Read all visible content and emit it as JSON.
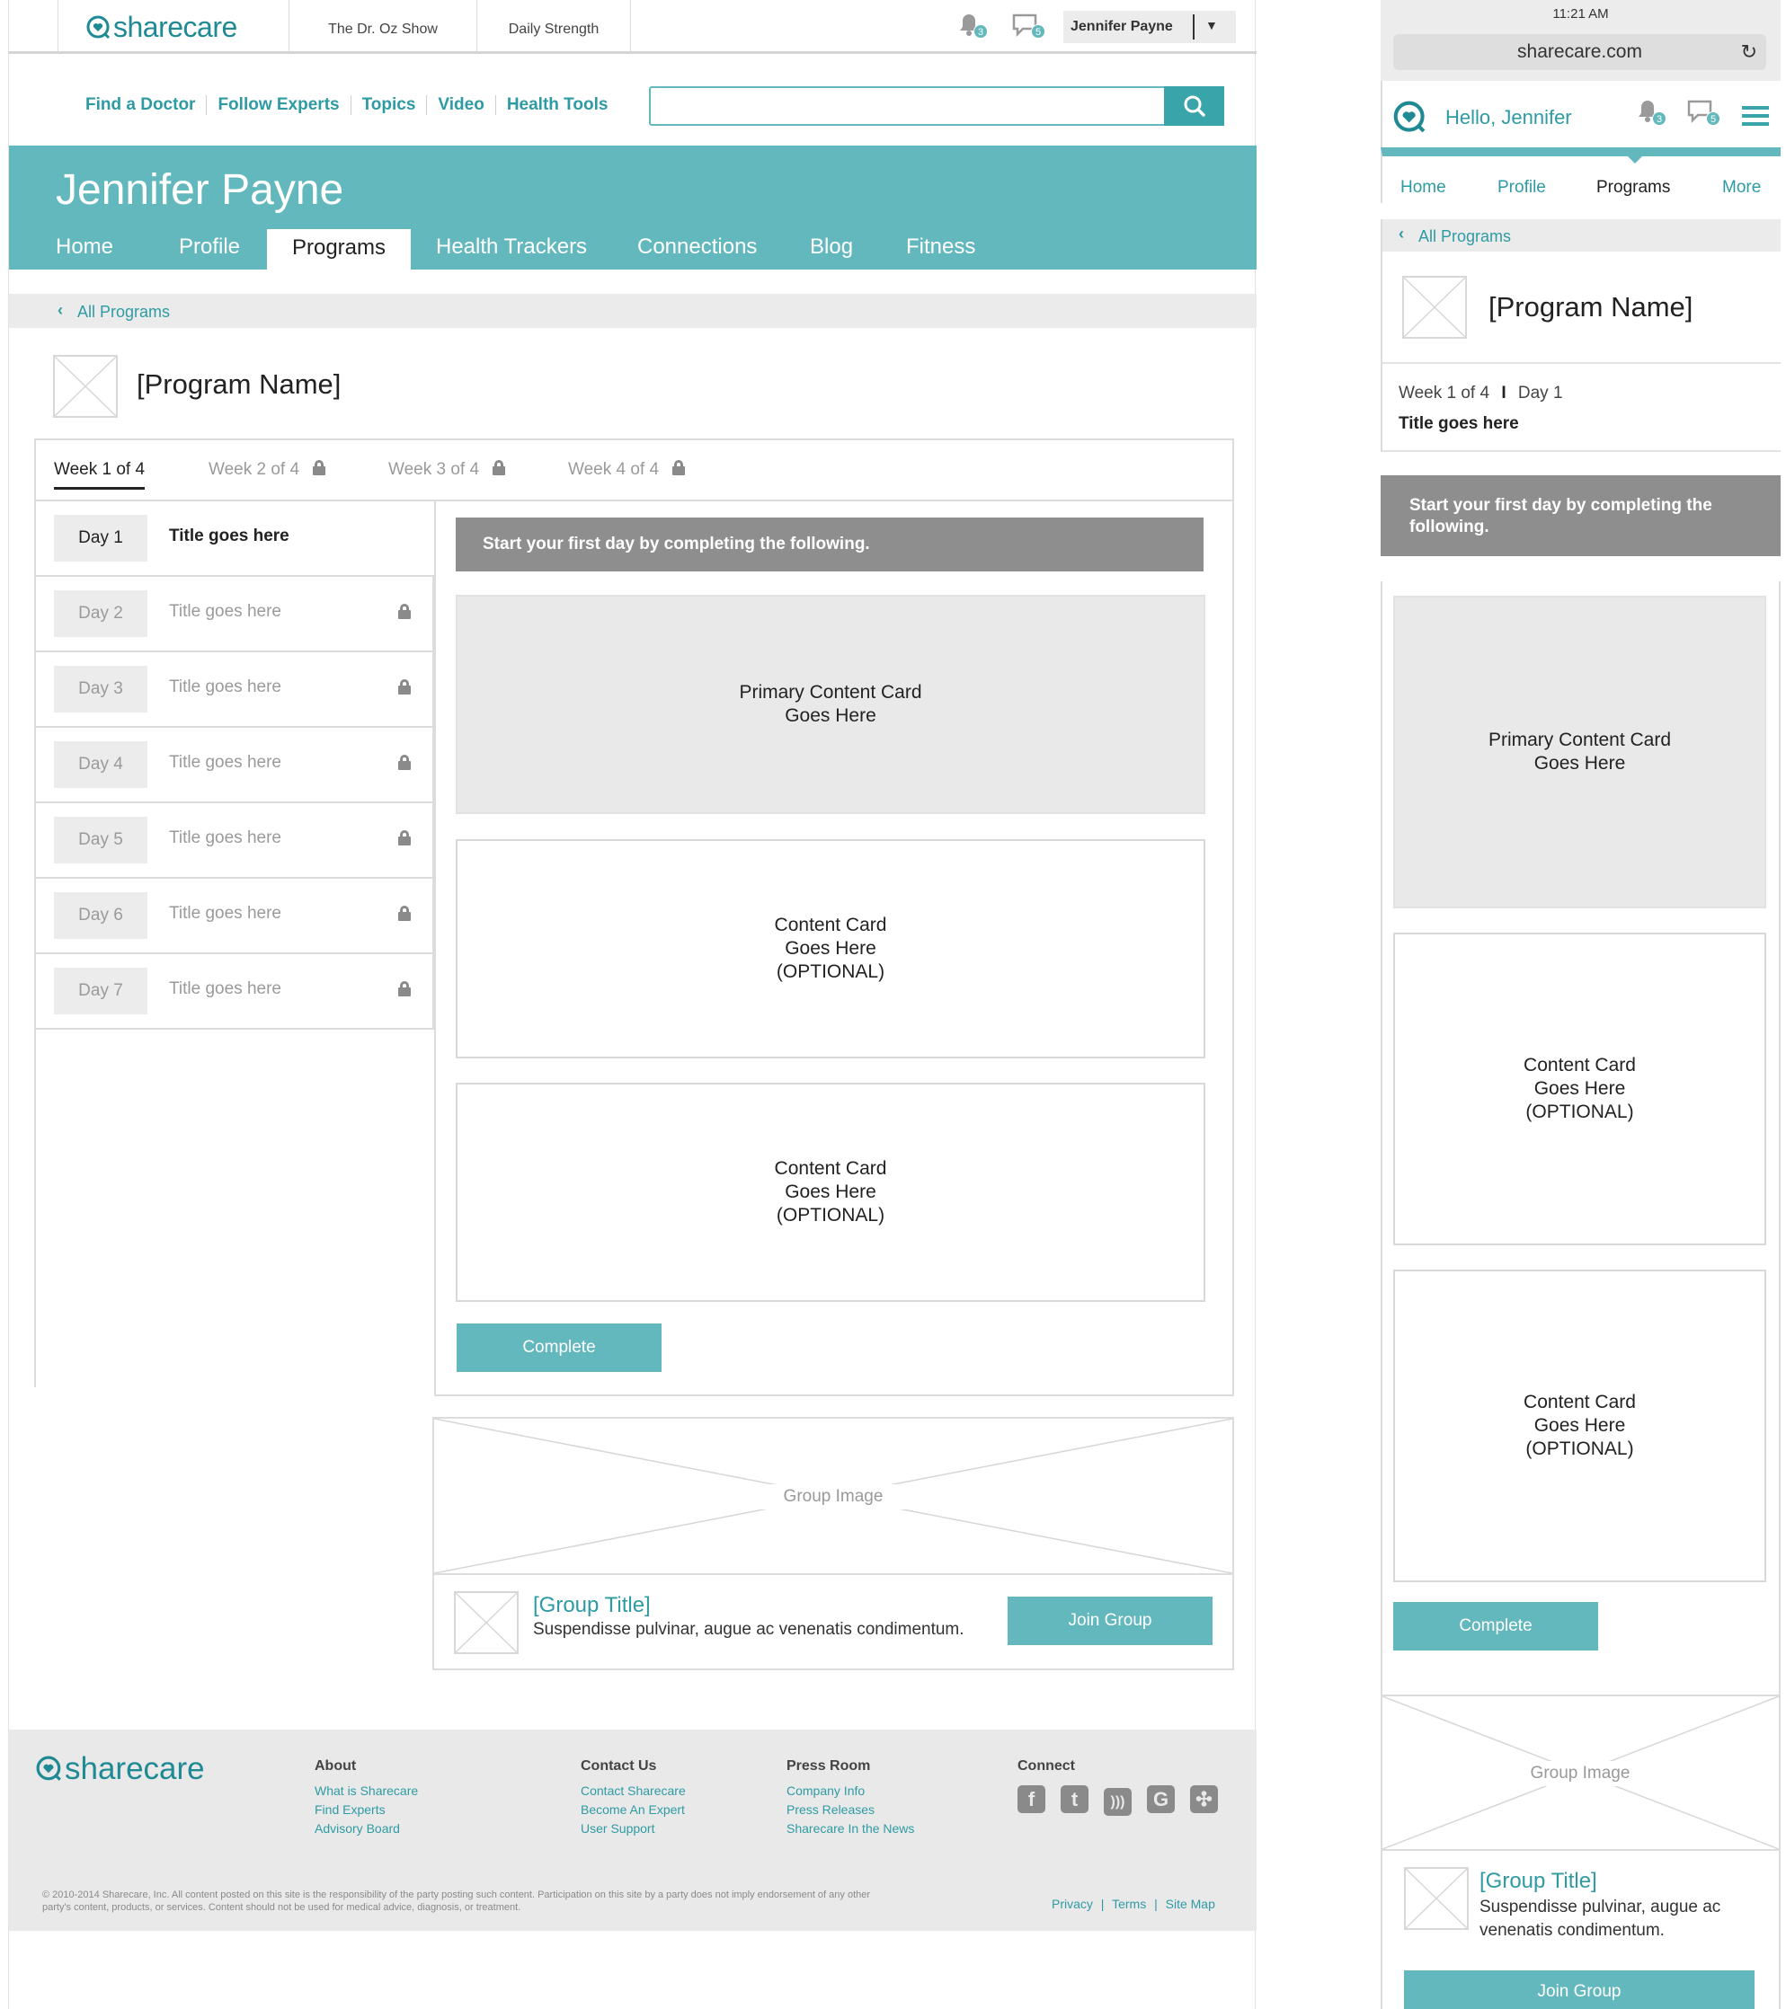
{
  "header": {
    "logo": "sharecare",
    "tabs": [
      "The Dr. Oz Show",
      "Daily Strength"
    ],
    "bell_count": "3",
    "chat_count": "5",
    "user_name": "Jennifer Payne",
    "dropdown_glyph": "▼"
  },
  "nav": {
    "links": [
      "Find a Doctor",
      "Follow Experts",
      "Topics",
      "Video",
      "Health Tools"
    ],
    "search_placeholder": ""
  },
  "profile": {
    "name": "Jennifer Payne",
    "tabs": [
      "Home",
      "Profile",
      "Programs",
      "Health Trackers",
      "Connections",
      "Blog",
      "Fitness"
    ],
    "active_tab": "Programs"
  },
  "breadcrumb": {
    "label": "All Programs"
  },
  "program": {
    "name": "[Program Name]",
    "weeks": [
      "Week 1 of 4",
      "Week 2 of 4",
      "Week 3 of 4",
      "Week 4 of 4"
    ],
    "days": [
      {
        "day": "Day 1",
        "title": "Title goes here",
        "locked": false
      },
      {
        "day": "Day 2",
        "title": "Title goes here",
        "locked": true
      },
      {
        "day": "Day 3",
        "title": "Title goes here",
        "locked": true
      },
      {
        "day": "Day 4",
        "title": "Title goes here",
        "locked": true
      },
      {
        "day": "Day 5",
        "title": "Title goes here",
        "locked": true
      },
      {
        "day": "Day 6",
        "title": "Title goes here",
        "locked": true
      },
      {
        "day": "Day 7",
        "title": "Title goes here",
        "locked": true
      }
    ],
    "banner": "Start your first day by completing the following.",
    "primary_card": "Primary Content Card\nGoes Here",
    "optional_card": "Content Card\nGoes Here\n(OPTIONAL)",
    "complete_label": "Complete"
  },
  "group": {
    "image_label": "Group Image",
    "title": "[Group Title]",
    "description": "Suspendisse pulvinar, augue ac venenatis condimentum.",
    "join_label": "Join Group"
  },
  "footer": {
    "logo": "sharecare",
    "columns": [
      {
        "heading": "About",
        "links": [
          "What is Sharecare",
          "Find Experts",
          "Advisory Board"
        ]
      },
      {
        "heading": "Contact Us",
        "links": [
          "Contact Sharecare",
          "Become An Expert",
          "User Support"
        ]
      },
      {
        "heading": "Press Room",
        "links": [
          "Company Info",
          "Press Releases",
          "Sharecare In the News"
        ]
      }
    ],
    "connect_heading": "Connect",
    "social_icons": [
      "facebook-icon",
      "twitter-icon",
      "rss-icon",
      "google-icon",
      "delicious-icon"
    ],
    "copyright": "© 2010-2014 Sharecare, Inc. All content posted on this site is the responsibility of the party posting such content. Participation on this site by a party does not imply endorsement of any other party's content, products, or services. Content should not be used for medical advice, diagnosis, or treatment.",
    "legal_links": [
      "Privacy",
      "Terms",
      "Site Map"
    ]
  },
  "mobile": {
    "time": "11:21 AM",
    "url": "sharecare.com",
    "greeting": "Hello, Jennifer",
    "bell_count": "3",
    "chat_count": "5",
    "tabs": [
      "Home",
      "Profile",
      "Programs",
      "More"
    ],
    "active_tab": "Programs",
    "breadcrumb": "All Programs",
    "program_name": "[Program Name]",
    "week": "Week 1 of 4",
    "day": "Day 1",
    "day_title": "Title goes here",
    "banner": "Start your first day by completing the following.",
    "primary_card": "Primary Content Card\nGoes Here",
    "optional_card": "Content Card\nGoes Here\n(OPTIONAL)",
    "complete_label": "Complete",
    "group_image_label": "Group Image",
    "group_title": "[Group Title]",
    "group_description": "Suspendisse pulvinar, augue ac venenatis condimentum.",
    "join_label": "Join Group"
  },
  "colors": {
    "accent": "#63b8bd",
    "link": "#2e9ba3",
    "banner": "#8e8e8e",
    "footer_bg": "#e9e9e9"
  }
}
